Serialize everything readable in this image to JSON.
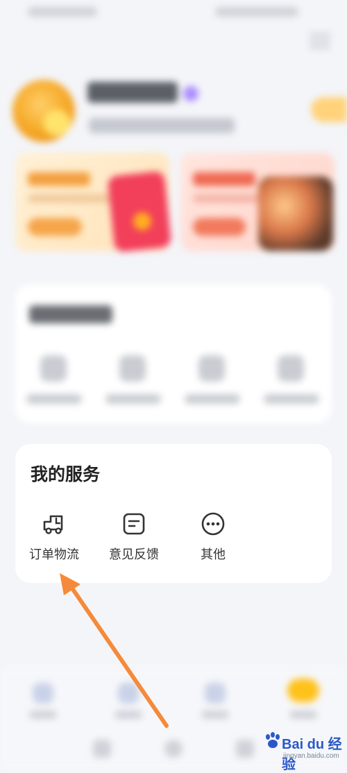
{
  "services": {
    "title": "我的服务",
    "items": [
      {
        "label": "订单物流",
        "icon": "truck-icon"
      },
      {
        "label": "意见反馈",
        "icon": "feedback-icon"
      },
      {
        "label": "其他",
        "icon": "more-icon"
      }
    ]
  },
  "watermark": {
    "logo": "Bai du 经验",
    "url": "jingyan.baidu.com"
  },
  "colors": {
    "annotation_arrow": "#f58a3a",
    "accent": "#ffc21a"
  }
}
